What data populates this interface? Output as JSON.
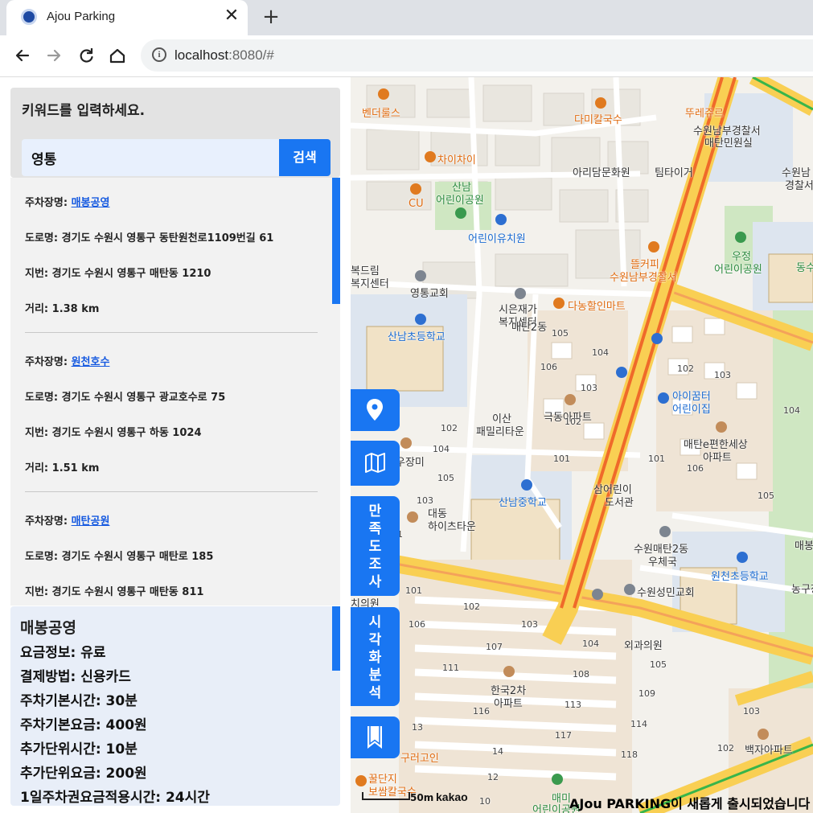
{
  "browser": {
    "tab_title": "Ajou Parking",
    "tab_close": "✕",
    "new_tab": "+",
    "url_host": "localhost",
    "url_rest": ":8080/#"
  },
  "search": {
    "title": "키워드를 입력하세요.",
    "value": "영통",
    "button": "검색"
  },
  "results": [
    {
      "name_label": "주차장명: ",
      "name": "매봉공영",
      "road": "도로명: 경기도 수원시 영통구 동탄원천로1109번길 61",
      "lot": "지번: 경기도 수원시 영통구 매탄동 1210",
      "dist": "거리: 1.38 km"
    },
    {
      "name_label": "주차장명: ",
      "name": "원천호수",
      "road": "도로명: 경기도 수원시 영통구 광교호수로 75",
      "lot": "지번: 경기도 수원시 영통구 하동 1024",
      "dist": "거리: 1.51 km"
    },
    {
      "name_label": "주차장명: ",
      "name": "매탄공원",
      "road": "도로명: 경기도 수원시 영통구 매탄로 185",
      "lot": "지번: 경기도 수원시 영통구 매탄동 811",
      "dist": ""
    }
  ],
  "detail": {
    "title": "매봉공영",
    "rows": [
      "요금정보: 유료",
      "결제방법: 신용카드",
      "주차기본시간: 30분",
      "주차기본요금: 400원",
      "추가단위시간: 10분",
      "추가단위요금: 200원",
      "1일주차권요금적용시간: 24시간"
    ]
  },
  "side_buttons": {
    "location_icon": "location-pin-icon",
    "map_icon": "map-icon",
    "survey": [
      "만",
      "족",
      "도",
      "조",
      "사"
    ],
    "analysis": [
      "시",
      "각",
      "화",
      "분",
      "석"
    ],
    "bookmark_icon": "bookmark-icon"
  },
  "map": {
    "labels": {
      "l1": "벤더룰스",
      "l2": "다미칼국수",
      "l3": "뚜레쥬르",
      "l4": "수원남부경찰서",
      "l5": "매탄민원실",
      "l6": "차이차이",
      "l7": "아리담문화원",
      "l8": "팀타이거",
      "l9": "수원남",
      "l10": "경찰서",
      "l11": "산남",
      "l12": "어린이공원",
      "l13": "CU",
      "l14": "어린이유치원",
      "l15": "우정",
      "l16": "어린이공원",
      "l17": "동수",
      "l18": "복드림",
      "l19": "복지센터",
      "l20": "뜰커피",
      "l21": "수원남부경찰서",
      "l22": "영통교회",
      "l23": "시은재가",
      "l24": "복지센터",
      "l25": "다농할인마트",
      "l26": "산남초등학교",
      "l27": "매탄2동",
      "l28": "아이꿈터",
      "l29": "어린이집",
      "l30": "이산",
      "l31": "패밀리타운",
      "l32": "극동아파트",
      "l33": "매탄e편한세상",
      "l34": "아파트",
      "l35": "우장미",
      "l36": "삼어린이",
      "l37": "도서관",
      "l38": "산남중학교",
      "l39": "대동",
      "l40": "하이츠타운",
      "l41": "수원매탄2동",
      "l42": "우체국",
      "l43": "원천초등학교",
      "l44": "농구장",
      "l45": "수원성민교회",
      "l46": "매봉",
      "l47": "외과의원",
      "l48": "한국2차",
      "l49": "아파트",
      "l50": "백자아파트",
      "l51": "구러고인",
      "l52": "꿀단지",
      "l53": "보쌈칼국수",
      "l54": "매미",
      "l55": "어린이공원",
      "l56": "치의원",
      "l57": "대동"
    },
    "numbers": {
      "n1": "105",
      "n2": "104",
      "n3": "106",
      "n4": "103",
      "n5": "102",
      "n6": "102",
      "n7": "104",
      "n8": "101",
      "n9": "105",
      "n10": "103",
      "n11": "102",
      "n12": "103",
      "n13": "104",
      "n14": "101",
      "n15": "106",
      "n16": "105",
      "n17": "101",
      "n18": "102",
      "n19": "103",
      "n20": "106",
      "n21": "107",
      "n22": "104",
      "n23": "105",
      "n24": "111",
      "n25": "108",
      "n26": "109",
      "n27": "116",
      "n28": "113",
      "n29": "114",
      "n30": "13",
      "n31": "117",
      "n32": "118",
      "n33": "14",
      "n34": "12",
      "n35": "10",
      "n36": "103",
      "n37": "102",
      "n38": "1",
      "n39": "104",
      "n40": "102"
    },
    "scale": "50m",
    "attribution": "kakao",
    "notice": "AJou PARKING이 새롭게 출시되었습니다"
  }
}
